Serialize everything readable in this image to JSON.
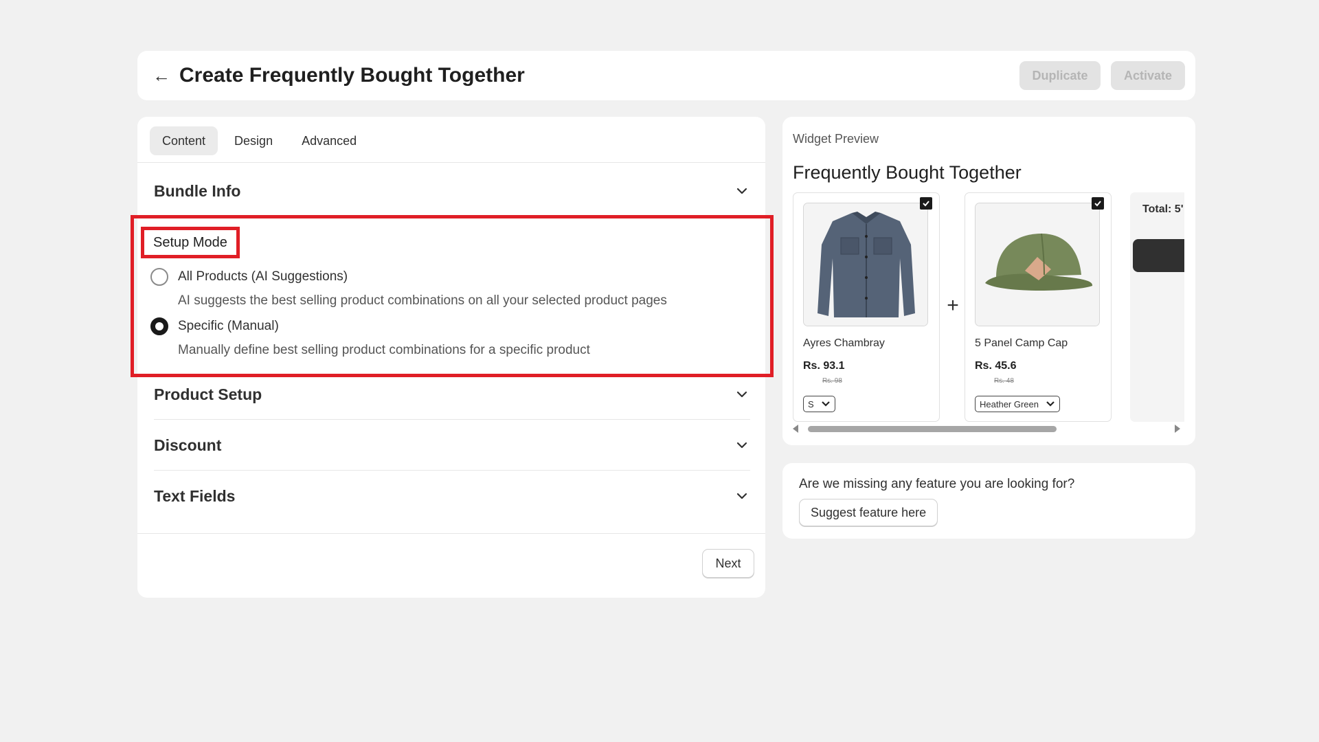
{
  "header": {
    "title": "Create Frequently Bought Together",
    "back_icon": "arrow-left-icon",
    "duplicate_label": "Duplicate",
    "activate_label": "Activate"
  },
  "tabs": [
    {
      "label": "Content",
      "active": true
    },
    {
      "label": "Design",
      "active": false
    },
    {
      "label": "Advanced",
      "active": false
    }
  ],
  "sections": {
    "bundle_info": "Bundle Info",
    "product_setup": "Product Setup",
    "discount": "Discount",
    "text_fields": "Text Fields"
  },
  "setup_mode": {
    "label": "Setup Mode",
    "options": [
      {
        "label": "All Products (AI Suggestions)",
        "description": "AI suggests the best selling product combinations on all your selected product pages",
        "selected": false
      },
      {
        "label": "Specific (Manual)",
        "description": "Manually define best selling product combinations for a specific product",
        "selected": true
      }
    ]
  },
  "next_label": "Next",
  "preview": {
    "label": "Widget Preview",
    "title": "Frequently Bought Together",
    "products": [
      {
        "name": "Ayres Chambray",
        "price": "Rs. 93.1",
        "old_price": "Rs. 98",
        "variant": "S",
        "checked": true
      },
      {
        "name": "5 Panel Camp Cap",
        "price": "Rs. 45.6",
        "old_price": "Rs. 48",
        "variant": "Heather Green",
        "checked": true
      }
    ],
    "plus": "+",
    "total_label": "Total: 5'",
    "scroll_position": 0.0
  },
  "feedback": {
    "question": "Are we missing any feature you are looking for?",
    "button_label": "Suggest feature here"
  },
  "colors": {
    "background": "#f1f1f1",
    "highlight": "#e01e26",
    "disabled_button": "#e3e3e3",
    "dark": "#303030"
  }
}
